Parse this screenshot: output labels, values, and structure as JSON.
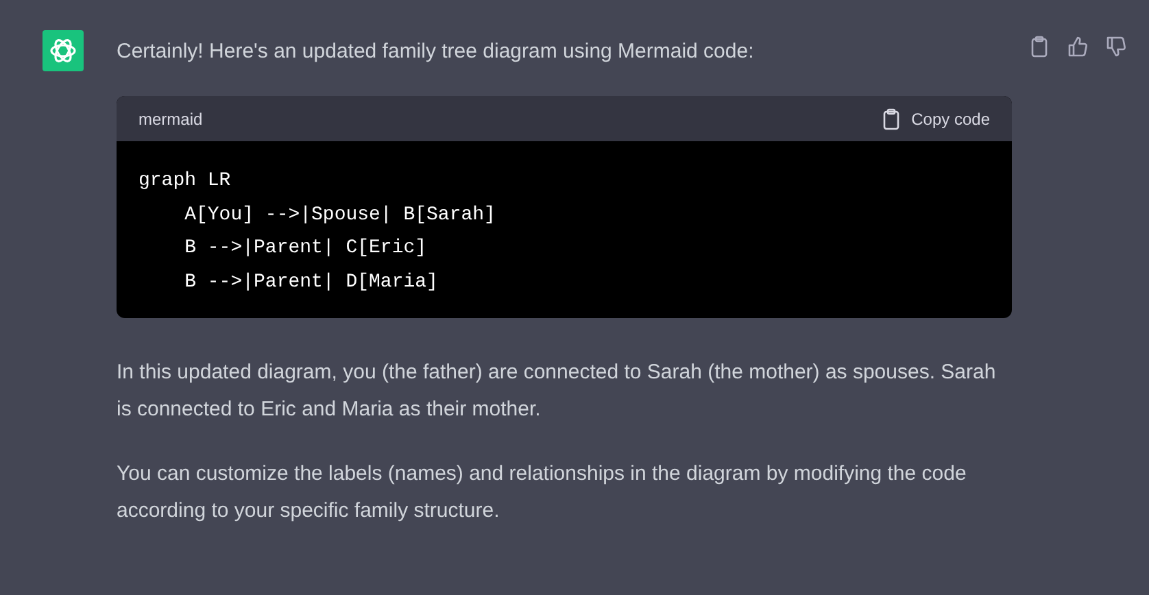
{
  "message": {
    "intro": "Certainly! Here's an updated family tree diagram using Mermaid code:",
    "code_block": {
      "language": "mermaid",
      "copy_label": "Copy code",
      "lines": [
        "graph LR",
        "    A[You] -->|Spouse| B[Sarah]",
        "    B -->|Parent| C[Eric]",
        "    B -->|Parent| D[Maria]"
      ]
    },
    "paragraphs": [
      "In this updated diagram, you (the father) are connected to Sarah (the mother) as spouses. Sarah is connected to Eric and Maria as their mother.",
      "You can customize the labels (names) and relationships in the diagram by modifying the code according to your specific family structure."
    ]
  }
}
